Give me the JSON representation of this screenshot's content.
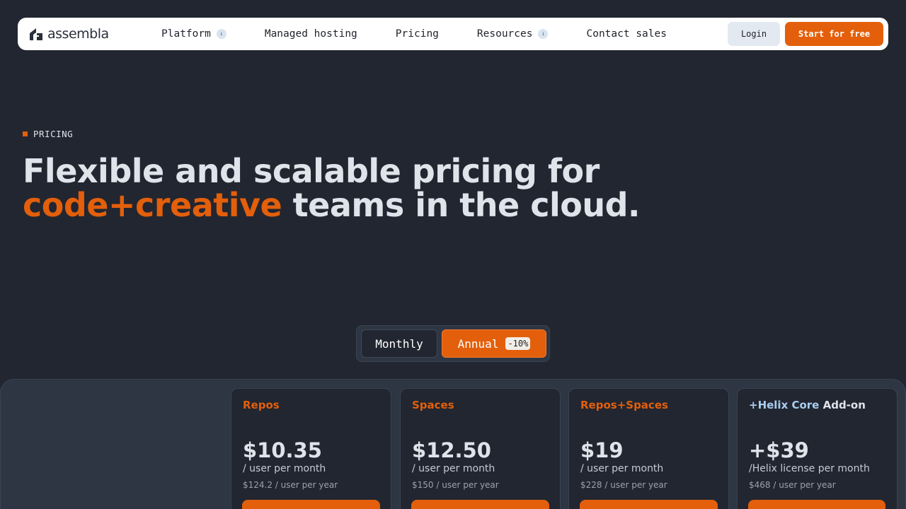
{
  "nav": {
    "logo_text": "assembla",
    "links": [
      {
        "label": "Platform",
        "has_dropdown": true
      },
      {
        "label": "Managed hosting",
        "has_dropdown": false
      },
      {
        "label": "Pricing",
        "has_dropdown": false
      },
      {
        "label": "Resources",
        "has_dropdown": true
      },
      {
        "label": "Contact sales",
        "has_dropdown": false
      }
    ],
    "login_label": "Login",
    "start_label": "Start for free"
  },
  "hero": {
    "eyebrow": "PRICING",
    "headline_line1": "Flexible and scalable pricing for",
    "headline_accent": "code+creative",
    "headline_line2_rest": " teams in the cloud."
  },
  "billing_toggle": {
    "monthly_label": "Monthly",
    "annual_label": "Annual",
    "annual_discount": "-10%",
    "selected": "Annual"
  },
  "plans": [
    {
      "name": "Repos",
      "price": "$10.35",
      "unit": "/ user per month",
      "yearly": "$124.2 / user per year"
    },
    {
      "name": "Spaces",
      "price": "$12.50",
      "unit": "/ user per month",
      "yearly": "$150 / user per year"
    },
    {
      "name": "Repos+Spaces",
      "price": "$19",
      "unit": "/ user per month",
      "yearly": "$228 / user per year"
    },
    {
      "name_highlight": "+Helix Core",
      "name_rest": " Add-on",
      "price": "+$39",
      "unit": "/Helix license per month",
      "yearly": "$468 / user per year"
    }
  ],
  "colors": {
    "background": "#222630",
    "accent": "#e35f0b",
    "helix_highlight": "#a9cdef",
    "panel": "#2d3642"
  }
}
